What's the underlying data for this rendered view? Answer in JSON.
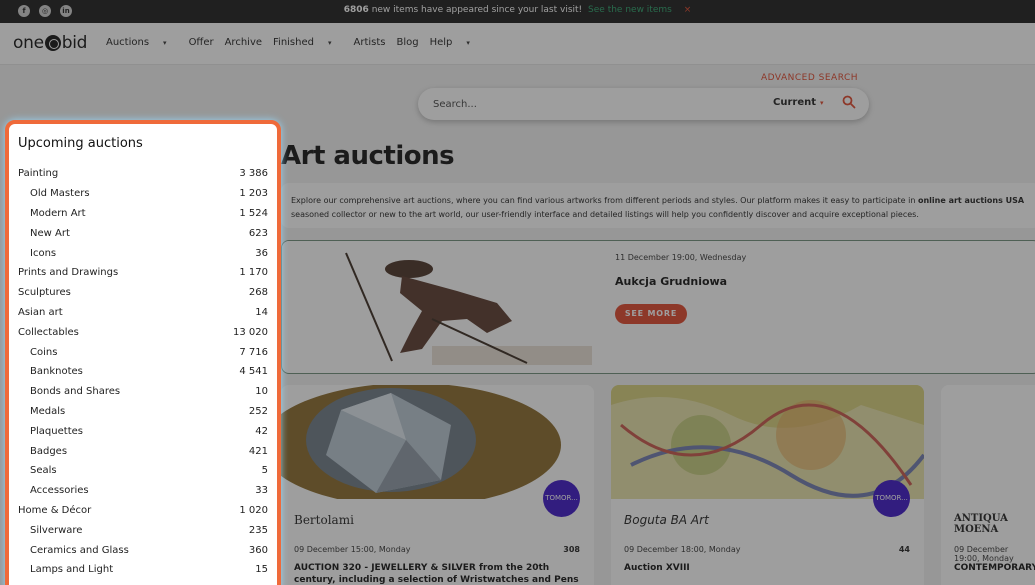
{
  "topbar": {
    "social": [
      "f",
      "◎",
      "in"
    ],
    "notice_count": "6806",
    "notice_text": "new items have appeared since your last visit!",
    "notice_link": "See the new items",
    "close": "×"
  },
  "header": {
    "logo_left": "one",
    "logo_right": "bid",
    "nav": [
      {
        "label": "Auctions",
        "caret": "▾"
      },
      {
        "label": "Offer",
        "caret": ""
      },
      {
        "label": "Archive",
        "caret": ""
      },
      {
        "label": "Finished",
        "caret": "▾"
      },
      {
        "label": "Artists",
        "caret": ""
      },
      {
        "label": "Blog",
        "caret": ""
      },
      {
        "label": "Help",
        "caret": "▾"
      }
    ]
  },
  "search": {
    "advanced": "ADVANCED SEARCH",
    "placeholder": "Search...",
    "scope": "Current",
    "scope_caret": "▾"
  },
  "sidebar": {
    "title": "Upcoming auctions",
    "categories": [
      {
        "label": "Painting",
        "count": "3 386",
        "sub": false
      },
      {
        "label": "Old Masters",
        "count": "1 203",
        "sub": true
      },
      {
        "label": "Modern Art",
        "count": "1 524",
        "sub": true
      },
      {
        "label": "New Art",
        "count": "623",
        "sub": true
      },
      {
        "label": "Icons",
        "count": "36",
        "sub": true
      },
      {
        "label": "Prints and Drawings",
        "count": "1 170",
        "sub": false
      },
      {
        "label": "Sculptures",
        "count": "268",
        "sub": false
      },
      {
        "label": "Asian art",
        "count": "14",
        "sub": false
      },
      {
        "label": "Collectables",
        "count": "13 020",
        "sub": false
      },
      {
        "label": "Coins",
        "count": "7 716",
        "sub": true
      },
      {
        "label": "Banknotes",
        "count": "4 541",
        "sub": true
      },
      {
        "label": "Bonds and Shares",
        "count": "10",
        "sub": true
      },
      {
        "label": "Medals",
        "count": "252",
        "sub": true
      },
      {
        "label": "Plaquettes",
        "count": "42",
        "sub": true
      },
      {
        "label": "Badges",
        "count": "421",
        "sub": true
      },
      {
        "label": "Seals",
        "count": "5",
        "sub": true
      },
      {
        "label": "Accessories",
        "count": "33",
        "sub": true
      },
      {
        "label": "Home & Décor",
        "count": "1 020",
        "sub": false
      },
      {
        "label": "Silverware",
        "count": "235",
        "sub": true
      },
      {
        "label": "Ceramics and Glass",
        "count": "360",
        "sub": true
      },
      {
        "label": "Lamps and Light",
        "count": "15",
        "sub": true
      }
    ]
  },
  "main": {
    "title": "Art auctions",
    "intro_1": "Explore our comprehensive art auctions, where you can find various artworks from different periods and styles. Our platform makes it easy to participate in ",
    "intro_bold": "online art auctions USA",
    "intro_2": " seasoned collector or new to the art world, our user-friendly interface and detailed listings will help you confidently discover and acquire exceptional pieces.",
    "featured": {
      "date": "11 December 19:00, Wednesday",
      "name": "Aukcja Grudniowa",
      "button": "SEE MORE"
    },
    "cards": [
      {
        "house": "Bertolami",
        "badge": "TOMOR...",
        "date": "09 December 15:00, Monday",
        "count": "308",
        "title": "AUCTION 320 - JEWELLERY & SILVER from the 20th century, including a selection of Wristwatches and Pens"
      },
      {
        "house": "Boguta BA Art",
        "badge": "TOMOR...",
        "date": "09 December 18:00, Monday",
        "count": "44",
        "title": "Auction XVIII"
      },
      {
        "house": "ANTIQUA MOENA",
        "badge": "",
        "date": "09 December 19:00, Monday",
        "count": "",
        "title": "CONTEMPORARY A"
      }
    ]
  },
  "colors": {
    "accent": "#e0452a",
    "badge": "#3b14c7",
    "highlight_border": "#ef6a3a",
    "link_green": "#2aa36b"
  }
}
